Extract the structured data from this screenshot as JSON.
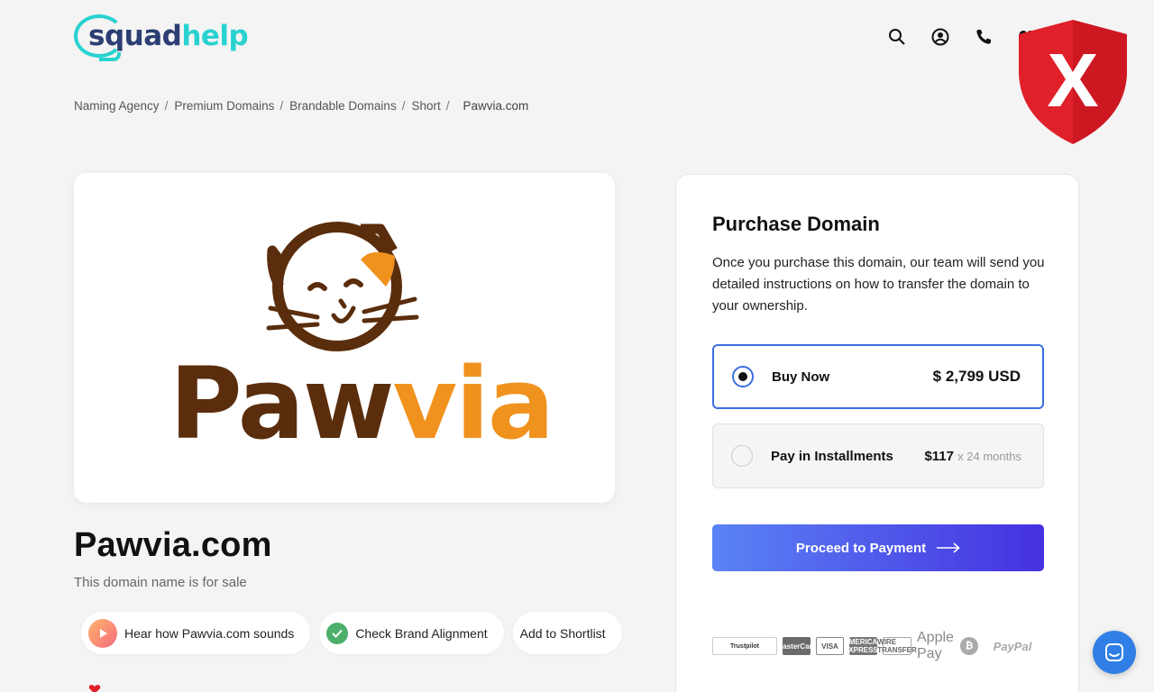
{
  "header": {
    "logo": {
      "part1": "squad",
      "part2": "help"
    },
    "icons": [
      "search-icon",
      "user-icon",
      "phone-icon",
      "heart-icon"
    ]
  },
  "breadcrumb": {
    "items": [
      "Naming Agency",
      "Premium Domains",
      "Brandable Domains",
      "Short"
    ],
    "separator": "/",
    "current": "Pawvia.com"
  },
  "brand_logo": {
    "text_dark": "Paw",
    "text_accent": "via"
  },
  "domain": {
    "name": "Pawvia.com",
    "subtitle": "This domain name is for sale"
  },
  "actions": {
    "hear": "Hear how Pawvia.com sounds",
    "check": "Check Brand Alignment",
    "shortlist": "Add to Shortlist"
  },
  "purchase": {
    "title": "Purchase Domain",
    "description": "Once you purchase this domain, our team will send you detailed instructions on how to transfer the domain to your ownership.",
    "options": [
      {
        "label": "Buy Now",
        "price": "$ 2,799 USD",
        "selected": true
      },
      {
        "label": "Pay in Installments",
        "price": "$117",
        "price_suffix": "x 24 months",
        "selected": false
      }
    ],
    "cta": "Proceed to Payment",
    "payment_badges": [
      "Trustpilot",
      "MasterCard",
      "VISA",
      "AMERICAN EXPRESS",
      "WIRE TRANSFER",
      "Apple Pay",
      "Bitcoin",
      "PayPal"
    ]
  },
  "colors": {
    "accent": "#28d2d0",
    "brand_dark": "#2c3e73",
    "logo_brown": "#5a2d0c",
    "logo_orange": "#f0921e",
    "selected_border": "#3b6fe0",
    "cta_start": "#5a83f5",
    "cta_end": "#4531e0",
    "shield_red": "#e0202a"
  }
}
